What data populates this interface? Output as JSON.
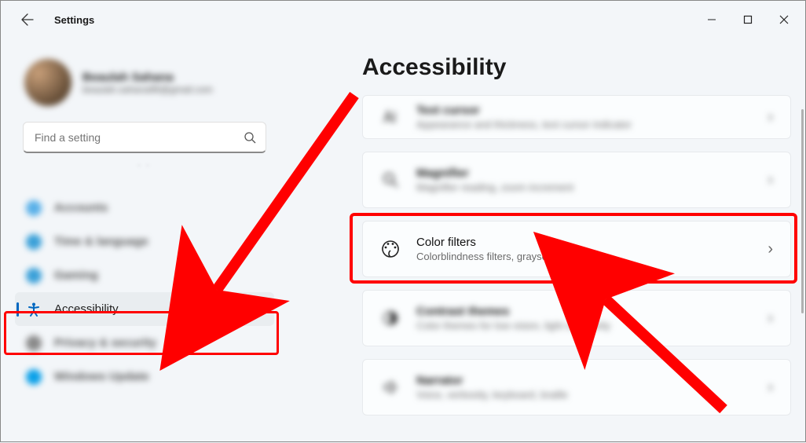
{
  "titlebar": {
    "app_title": "Settings"
  },
  "user": {
    "name": "Beaulah Sahana",
    "email": "beaulah.sahana96@gmail.com"
  },
  "search": {
    "placeholder": "Find a setting"
  },
  "sidebar": {
    "items": [
      {
        "label": "Accounts",
        "icon_color": "#59b0e8"
      },
      {
        "label": "Time & language",
        "icon_color": "#3aa0d8"
      },
      {
        "label": "Gaming",
        "icon_color": "#3aa0d8"
      },
      {
        "label": "Accessibility",
        "icon_color": "#0067c0",
        "selected": true
      },
      {
        "label": "Privacy & security",
        "icon_color": "#6a6a6a"
      },
      {
        "label": "Windows Update",
        "icon_color": "#0aa0e8"
      }
    ]
  },
  "page": {
    "heading": "Accessibility",
    "rows": [
      {
        "title": "Text cursor",
        "sub": "Appearance and thickness, text cursor indicator"
      },
      {
        "title": "Magnifier",
        "sub": "Magnifier reading, zoom increment"
      },
      {
        "title": "Color filters",
        "sub": "Colorblindness filters, grayscale, inverted"
      },
      {
        "title": "Contrast themes",
        "sub": "Color themes for low vision, light sensitivity"
      },
      {
        "title": "Narrator",
        "sub": "Voice, verbosity, keyboard, braille"
      }
    ]
  },
  "annotations": {
    "color": "#ff0000"
  }
}
